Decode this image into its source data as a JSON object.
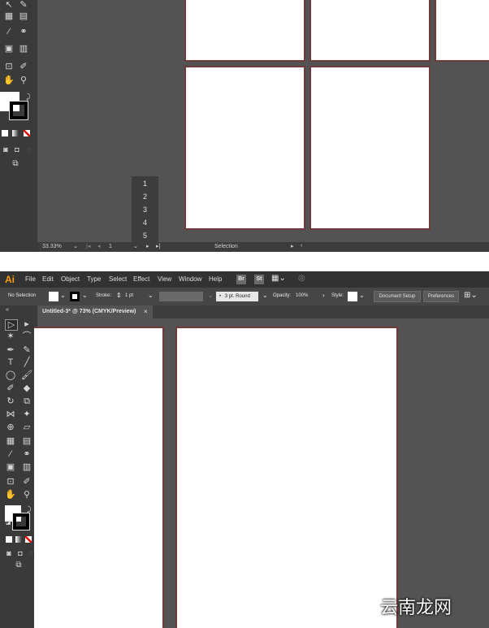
{
  "top_panel": {
    "zoom": "33.33%",
    "page": "1",
    "status_text": "Selection",
    "page_menu": [
      "1",
      "2",
      "3",
      "4",
      "5"
    ]
  },
  "bottom_panel": {
    "app_logo": "Ai",
    "menus": [
      "File",
      "Edit",
      "Object",
      "Type",
      "Select",
      "Effect",
      "View",
      "Window",
      "Help"
    ],
    "bridge_label": "Br",
    "stock_label": "St",
    "control": {
      "selection": "No Selection",
      "stroke_label": "Stroke:",
      "stroke_value": "1 pt",
      "brush": "3 pt. Round",
      "opacity_label": "Opacity:",
      "opacity_value": "100%",
      "style_label": "Style:",
      "document_setup": "Document Setup",
      "preferences": "Preferences"
    },
    "document_tab": "Untitled-3* @ 73% (CMYK/Preview)",
    "tab_close": "×"
  },
  "watermark": "云南龙网",
  "colors": {
    "workspace": "#535353",
    "artboard_border": "#6e3a3a",
    "accent_logo": "#ff9a00"
  }
}
